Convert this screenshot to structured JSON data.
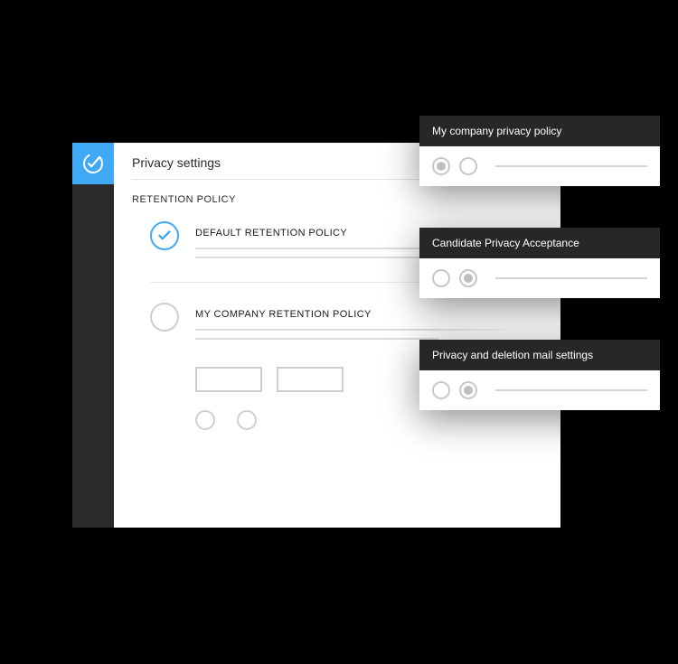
{
  "colors": {
    "accent": "#3fa9f5",
    "sidebar": "#2b2b2b",
    "card_header": "#272727"
  },
  "page": {
    "title": "Privacy settings"
  },
  "section": {
    "label": "RETENTION POLICY"
  },
  "options": [
    {
      "title": "DEFAULT RETENTION POLICY",
      "selected": true
    },
    {
      "title": "MY COMPANY RETENTION POLICY",
      "selected": false
    }
  ],
  "cards": [
    {
      "title": "My company privacy policy",
      "selected_index": 0
    },
    {
      "title": "Candidate Privacy Acceptance",
      "selected_index": 1
    },
    {
      "title": "Privacy and deletion mail settings",
      "selected_index": 1
    }
  ]
}
